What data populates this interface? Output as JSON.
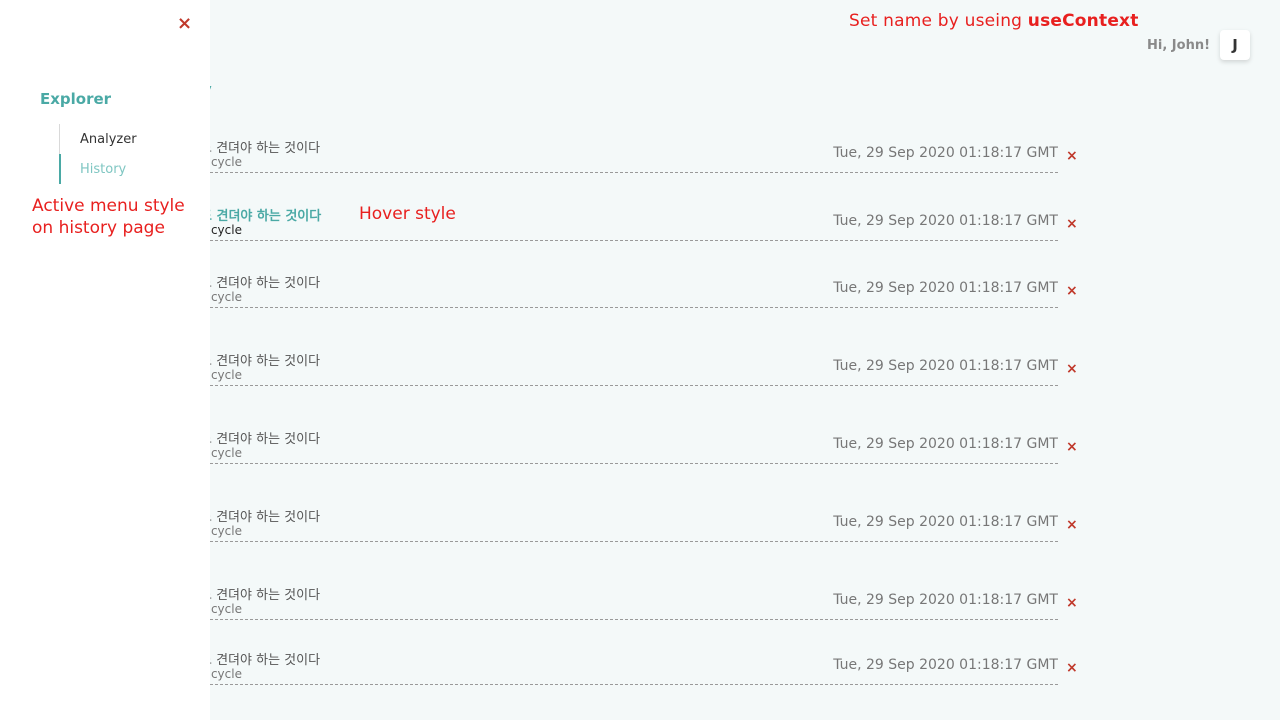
{
  "annotations": {
    "context_prefix": "Set name by useing ",
    "context_strong": "useContext",
    "hover_style": "Hover style",
    "active_menu_style": "Active menu style on history page"
  },
  "user": {
    "greeting": "Hi, John!",
    "avatar_initial": "J"
  },
  "sidebar": {
    "close_icon": "×",
    "section_title": "Explorer",
    "items": [
      {
        "label": "Analyzer",
        "active": false
      },
      {
        "label": "History",
        "active": true
      }
    ]
  },
  "page": {
    "title_fragment": "y"
  },
  "history": {
    "delete_icon": "×",
    "items": [
      {
        "title": "도 견뎌야 하는 것이다",
        "subtitle": "bicycle",
        "date": "Tue, 29 Sep 2020 01:18:17 GMT"
      },
      {
        "title": "도 견뎌야 하는 것이다",
        "subtitle": "bicycle",
        "date": "Tue, 29 Sep 2020 01:18:17 GMT"
      },
      {
        "title": "도 견뎌야 하는 것이다",
        "subtitle": "bicycle",
        "date": "Tue, 29 Sep 2020 01:18:17 GMT"
      },
      {
        "title": "도 견뎌야 하는 것이다",
        "subtitle": "bicycle",
        "date": "Tue, 29 Sep 2020 01:18:17 GMT"
      },
      {
        "title": "도 견뎌야 하는 것이다",
        "subtitle": "bicycle",
        "date": "Tue, 29 Sep 2020 01:18:17 GMT"
      },
      {
        "title": "도 견뎌야 하는 것이다",
        "subtitle": "bicycle",
        "date": "Tue, 29 Sep 2020 01:18:17 GMT"
      },
      {
        "title": "도 견뎌야 하는 것이다",
        "subtitle": "bicycle",
        "date": "Tue, 29 Sep 2020 01:18:17 GMT"
      },
      {
        "title": "도 견뎌야 하는 것이다",
        "subtitle": "bicycle",
        "date": "Tue, 29 Sep 2020 01:18:17 GMT"
      }
    ]
  },
  "colors": {
    "accent": "#4aa9a5",
    "annotation": "#e8201f",
    "delete": "#c0392b"
  }
}
